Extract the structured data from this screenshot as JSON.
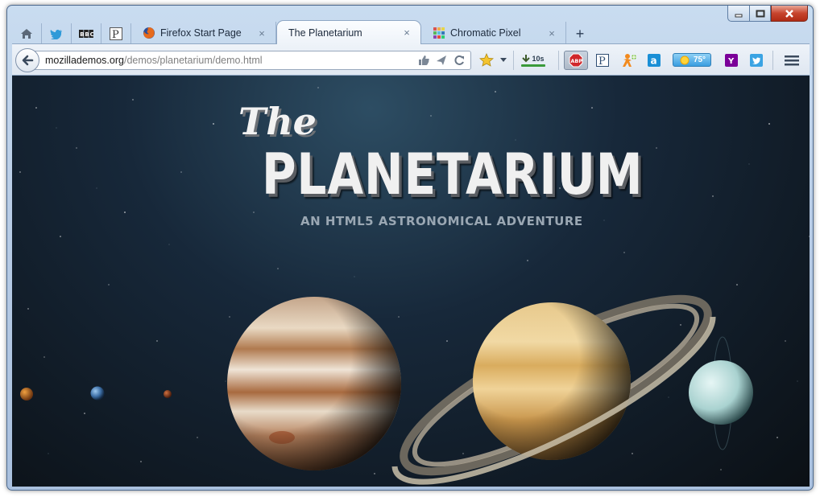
{
  "window": {
    "caption": {
      "minimize_icon": "minimize-icon",
      "maximize_icon": "maximize-icon",
      "close_icon": "close-icon"
    }
  },
  "tabs": {
    "pinned": [
      {
        "name": "home",
        "icon": "home-icon"
      },
      {
        "name": "twitter",
        "icon": "twitter-bird-icon"
      },
      {
        "name": "bbc",
        "icon": "bbc-icon",
        "text": "BBC"
      },
      {
        "name": "pocket",
        "icon": "pocket-p-icon",
        "text": "P"
      }
    ],
    "items": [
      {
        "title": "Firefox Start Page",
        "icon": "firefox-icon",
        "active": false
      },
      {
        "title": "The Planetarium",
        "icon": "",
        "active": true
      },
      {
        "title": "Chromatic Pixel",
        "icon": "chromatic-pixel-icon",
        "active": false
      }
    ],
    "close_glyph": "×",
    "new_tab_glyph": "+"
  },
  "navbar": {
    "url_host": "mozillademos.org",
    "url_path": "/demos/planetarium/demo.html",
    "download_label": "10s",
    "weather_label": "75°",
    "abp_label": "ABP",
    "pocket_label": "P",
    "amazon_label": "a",
    "yahoo_label": "Y"
  },
  "page": {
    "title_the": "The",
    "title_main": "PLANETARIUM",
    "subtitle": "AN HTML5 ASTRONOMICAL ADVENTURE"
  },
  "colors": {
    "accent": "#4a90d9",
    "close_button": "#c7442d",
    "space_bg": "#0b1015"
  }
}
